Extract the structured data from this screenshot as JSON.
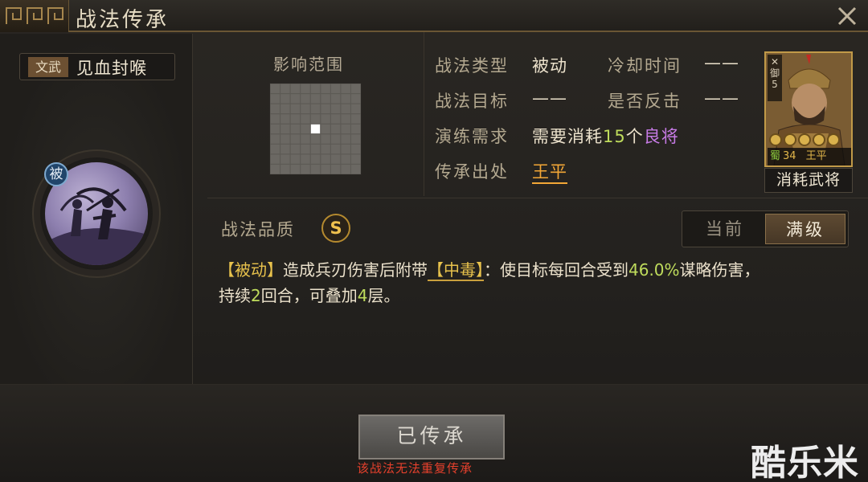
{
  "window": {
    "title": "战法传承"
  },
  "skill": {
    "type_tag": "文武",
    "name": "见血封喉",
    "passive_badge": "被"
  },
  "range": {
    "label": "影响范围",
    "grid_size": 9,
    "highlight": [
      4,
      4
    ]
  },
  "info": {
    "type_label": "战法类型",
    "type_value": "被动",
    "cooldown_label": "冷却时间",
    "cooldown_value": "——",
    "target_label": "战法目标",
    "target_value": "——",
    "counter_label": "是否反击",
    "counter_value": "——",
    "training_label": "演练需求",
    "training_prefix": "需要消耗",
    "training_count": "15",
    "training_unit": "个",
    "training_quality": "良将",
    "origin_label": "传承出处",
    "origin_value": "王平"
  },
  "hero": {
    "side_text": "御",
    "side_level": "5",
    "faction": "蜀",
    "level": "34",
    "name": "王平",
    "stars": 5,
    "caption": "消耗武将"
  },
  "quality": {
    "label": "战法品质",
    "grade": "S"
  },
  "toggle": {
    "current": "当前",
    "max": "满级"
  },
  "description": {
    "tag": "【被动】",
    "part1": "造成兵刃伤害后附带",
    "status": "【中毒】",
    "part2": "：使目标每回合受到",
    "percent": "46.0%",
    "part3": "谋略伤害，",
    "part4": "持续",
    "turns": "2",
    "part5": "回合，可叠加",
    "stacks": "4",
    "part6": "层。"
  },
  "footer": {
    "button": "已传承",
    "warning": "该战法无法重复传承"
  },
  "watermark": "酷乐米"
}
